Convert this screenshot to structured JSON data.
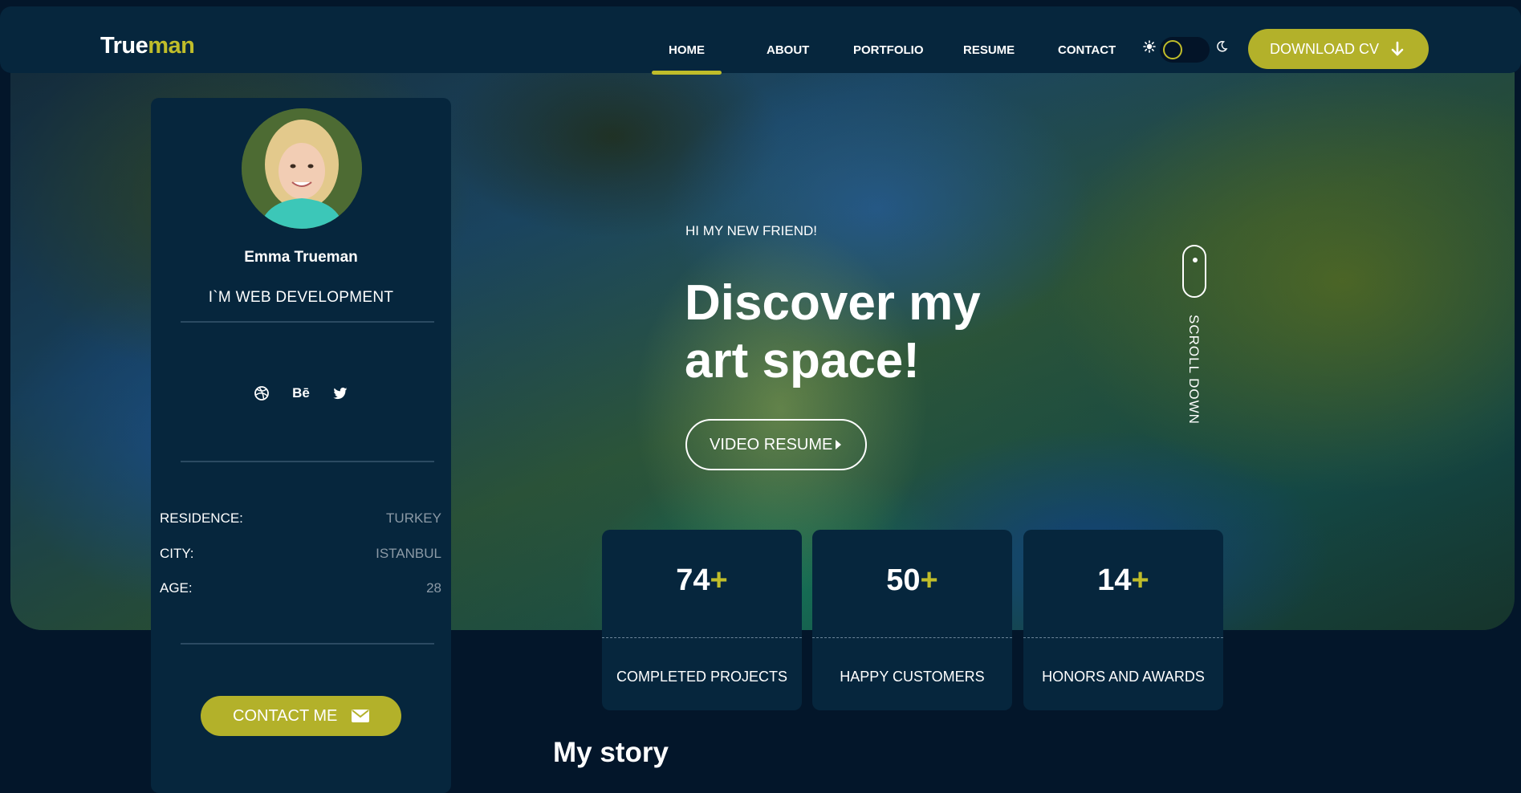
{
  "header": {
    "logo_part1": "True",
    "logo_part2": "man",
    "nav": [
      "HOME",
      "ABOUT",
      "PORTFOLIO",
      "RESUME",
      "CONTACT"
    ],
    "active_nav": "HOME",
    "theme_toggle": {
      "state": "dark",
      "icons": [
        "sun-icon",
        "moon-icon"
      ]
    },
    "download_label": "DOWNLOAD CV"
  },
  "hero": {
    "eyebrow": "HI MY NEW FRIEND!",
    "title_line1": "Discover my",
    "title_line2": "art space!",
    "video_label": "VIDEO RESUME",
    "scroll_label": "SCROLL DOWN"
  },
  "stats": [
    {
      "number": "74",
      "plus": "+",
      "label": "COMPLETED PROJECTS"
    },
    {
      "number": "50",
      "plus": "+",
      "label": "HAPPY CUSTOMERS"
    },
    {
      "number": "14",
      "plus": "+",
      "label": "HONORS AND AWARDS"
    }
  ],
  "profile": {
    "name": "Emma Trueman",
    "role": "I`M WEB DEVELOPMENT",
    "socials": [
      "dribbble-icon",
      "behance-icon",
      "twitter-icon"
    ],
    "behance_text": "Bē",
    "info": [
      {
        "key": "RESIDENCE:",
        "value": "TURKEY"
      },
      {
        "key": "CITY:",
        "value": "ISTANBUL"
      },
      {
        "key": "AGE:",
        "value": "28"
      }
    ],
    "contact_label": "CONTACT ME"
  },
  "story": {
    "title": "My story"
  },
  "colors": {
    "accent": "#c0bd2a",
    "background": "#03162a",
    "panel": "#06263d"
  }
}
